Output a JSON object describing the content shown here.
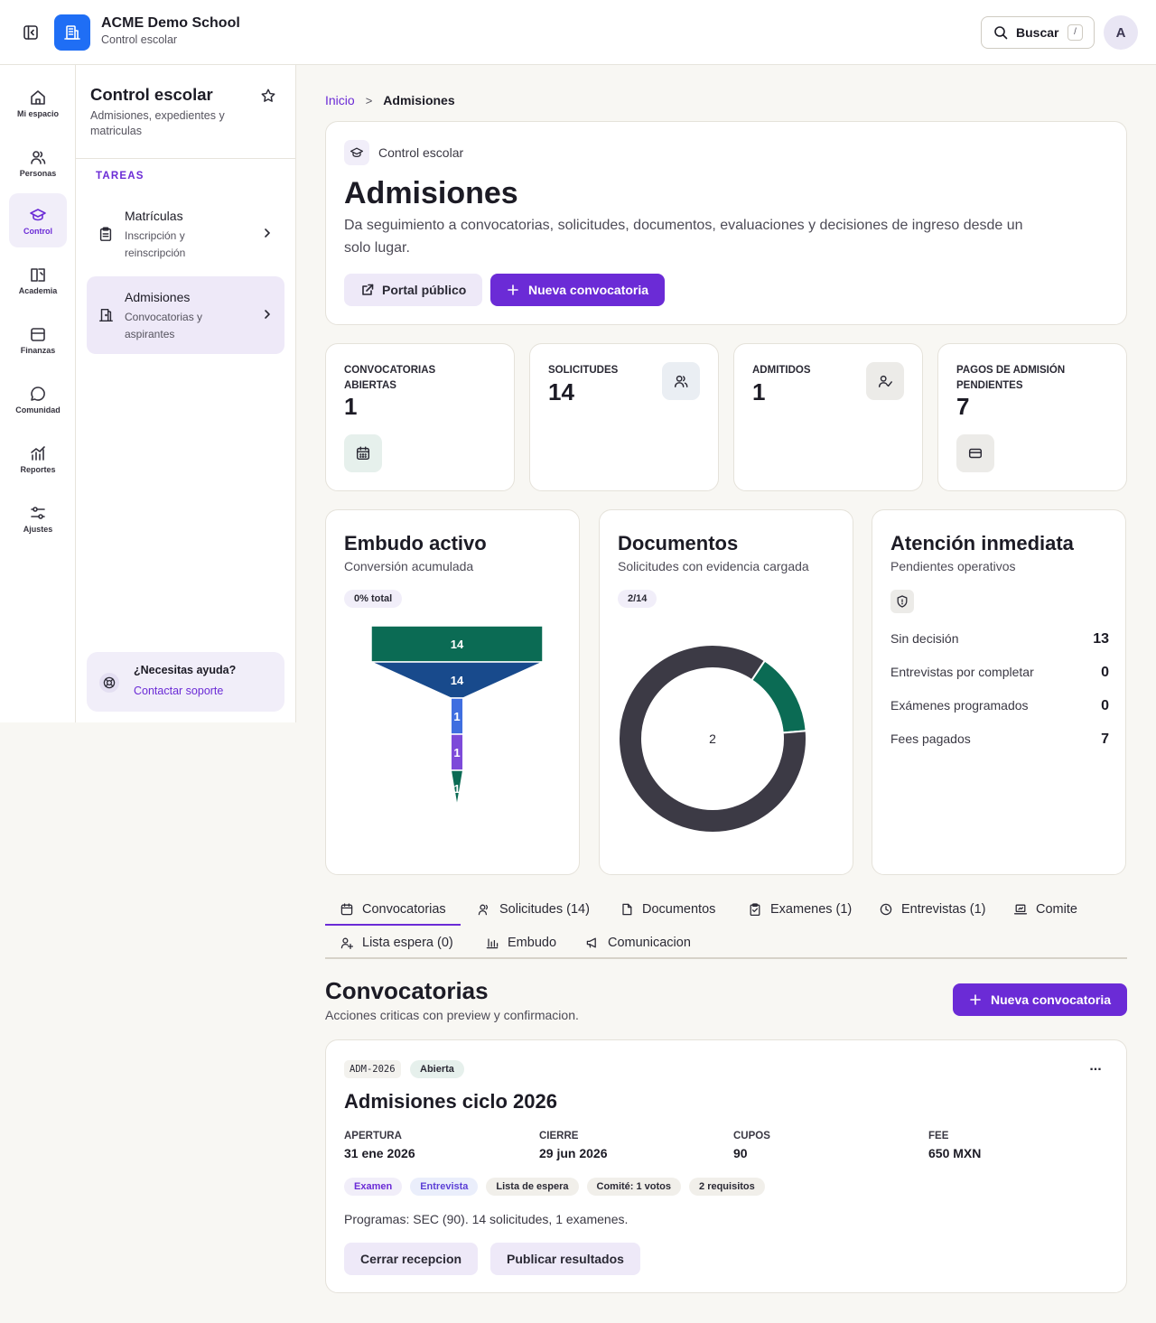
{
  "header": {
    "brand_name": "ACME Demo School",
    "brand_sub": "Control escolar",
    "search_label": "Buscar",
    "search_shortcut": "/",
    "avatar_initial": "A"
  },
  "rail": [
    {
      "label": "Mi espacio",
      "icon": "home-icon"
    },
    {
      "label": "Personas",
      "icon": "users-icon"
    },
    {
      "label": "Control",
      "icon": "graduation-cap-icon",
      "active": true
    },
    {
      "label": "Academia",
      "icon": "book-icon"
    },
    {
      "label": "Finanzas",
      "icon": "wallet-icon"
    },
    {
      "label": "Comunidad",
      "icon": "chat-icon"
    },
    {
      "label": "Reportes",
      "icon": "chart-icon"
    },
    {
      "label": "Ajustes",
      "icon": "sliders-icon"
    }
  ],
  "subnav": {
    "title": "Control escolar",
    "description": "Admisiones, expedientes y matriculas",
    "section_label": "TAREAS",
    "items": [
      {
        "title": "Matrículas",
        "subtitle": "Inscripción y reinscripción",
        "icon": "clipboard-icon"
      },
      {
        "title": "Admisiones",
        "subtitle": "Convocatorias y aspirantes",
        "icon": "door-icon",
        "active": true
      }
    ],
    "help_title": "¿Necesitas ayuda?",
    "help_link": "Contactar soporte"
  },
  "breadcrumb": {
    "home": "Inicio",
    "separator": ">",
    "current": "Admisiones"
  },
  "hero": {
    "kicker": "Control escolar",
    "title": "Admisiones",
    "description": "Da seguimiento a convocatorias, solicitudes, documentos, evaluaciones y decisiones de ingreso desde un solo lugar.",
    "portal_button": "Portal público",
    "new_button": "Nueva convocatoria"
  },
  "stats": [
    {
      "label": "CONVOCATORIAS ABIERTAS",
      "value": "1",
      "icon": "calendar-icon"
    },
    {
      "label": "SOLICITUDES",
      "value": "14",
      "icon": "users-icon"
    },
    {
      "label": "ADMITIDOS",
      "value": "1",
      "icon": "user-check-icon"
    },
    {
      "label": "PAGOS DE ADMISIÓN PENDIENTES",
      "value": "7",
      "icon": "card-icon"
    }
  ],
  "funnel_panel": {
    "title": "Embudo activo",
    "subtitle": "Conversión acumulada",
    "pill": "0% total"
  },
  "documents_panel": {
    "title": "Documentos",
    "subtitle": "Solicitudes con evidencia cargada",
    "pill": "2/14",
    "center_label": "2"
  },
  "attention_panel": {
    "title": "Atención inmediata",
    "subtitle": "Pendientes operativos",
    "rows": [
      {
        "label": "Sin decisión",
        "value": "13"
      },
      {
        "label": "Entrevistas por completar",
        "value": "0"
      },
      {
        "label": "Exámenes programados",
        "value": "0"
      },
      {
        "label": "Fees pagados",
        "value": "7"
      }
    ]
  },
  "chart_data": [
    {
      "type": "funnel",
      "stages": [
        {
          "value": 14,
          "color": "#0b6b54"
        },
        {
          "value": 14,
          "color": "#184a8c"
        },
        {
          "value": 1,
          "color": "#3f6ee0"
        },
        {
          "value": 1,
          "color": "#7d4ad9"
        },
        {
          "value": 1,
          "color": "#0b6b54"
        }
      ]
    },
    {
      "type": "pie",
      "variant": "donut",
      "slices": [
        {
          "value": 2,
          "color": "#0b6b54"
        },
        {
          "value": 12,
          "color": "#3c3a45"
        }
      ],
      "total": 14
    }
  ],
  "tabs": [
    {
      "label": "Convocatorias",
      "icon": "calendar-icon",
      "active": true
    },
    {
      "label": "Solicitudes (14)",
      "icon": "users-icon"
    },
    {
      "label": "Documentos",
      "icon": "file-icon"
    },
    {
      "label": "Examenes (1)",
      "icon": "clipboard-check-icon"
    },
    {
      "label": "Entrevistas (1)",
      "icon": "clock-icon"
    },
    {
      "label": "Comite",
      "icon": "laptop-icon"
    },
    {
      "label": "Lista espera (0)",
      "icon": "user-plus-icon"
    },
    {
      "label": "Embudo",
      "icon": "bar-chart-icon"
    },
    {
      "label": "Comunicacion",
      "icon": "megaphone-icon"
    }
  ],
  "section": {
    "title": "Convocatorias",
    "subtitle": "Acciones criticas con preview y confirmacion.",
    "new_button": "Nueva convocatoria"
  },
  "convocatoria": {
    "code": "ADM-2026",
    "status": "Abierta",
    "more": "...",
    "title": "Admisiones ciclo 2026",
    "fields": [
      {
        "label": "APERTURA",
        "value": "31 ene 2026"
      },
      {
        "label": "CIERRE",
        "value": "29 jun 2026"
      },
      {
        "label": "CUPOS",
        "value": "90"
      },
      {
        "label": "FEE",
        "value": "650 MXN"
      }
    ],
    "chips": [
      "Examen",
      "Entrevista",
      "Lista de espera",
      "Comité: 1 votos",
      "2 requisitos"
    ],
    "note": "Programas: SEC (90). 14 solicitudes, 1 examenes.",
    "close_button": "Cerrar recepcion",
    "publish_button": "Publicar resultados"
  },
  "colors": {
    "accent": "#6b2bd6",
    "brand": "#1f6ef5",
    "success": "#0b6b54"
  }
}
